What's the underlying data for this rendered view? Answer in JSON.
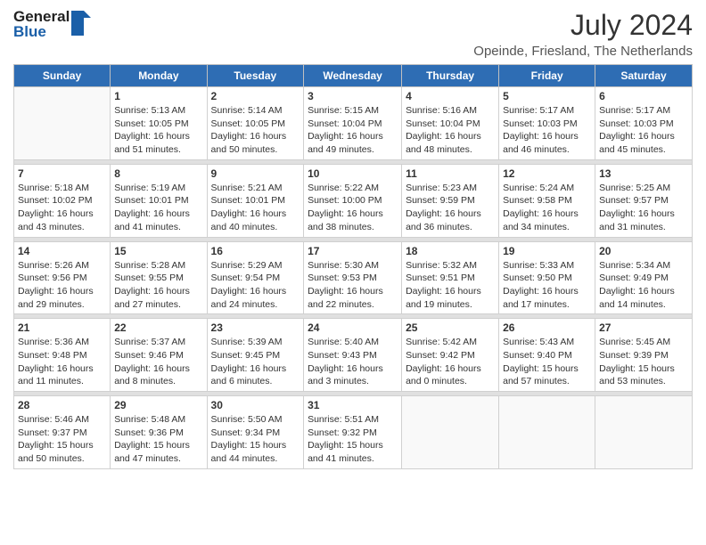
{
  "header": {
    "logo_general": "General",
    "logo_blue": "Blue",
    "month_year": "July 2024",
    "location": "Opeinde, Friesland, The Netherlands"
  },
  "days_of_week": [
    "Sunday",
    "Monday",
    "Tuesday",
    "Wednesday",
    "Thursday",
    "Friday",
    "Saturday"
  ],
  "weeks": [
    [
      {
        "day": "",
        "sunrise": "",
        "sunset": "",
        "daylight": ""
      },
      {
        "day": "1",
        "sunrise": "Sunrise: 5:13 AM",
        "sunset": "Sunset: 10:05 PM",
        "daylight": "Daylight: 16 hours and 51 minutes."
      },
      {
        "day": "2",
        "sunrise": "Sunrise: 5:14 AM",
        "sunset": "Sunset: 10:05 PM",
        "daylight": "Daylight: 16 hours and 50 minutes."
      },
      {
        "day": "3",
        "sunrise": "Sunrise: 5:15 AM",
        "sunset": "Sunset: 10:04 PM",
        "daylight": "Daylight: 16 hours and 49 minutes."
      },
      {
        "day": "4",
        "sunrise": "Sunrise: 5:16 AM",
        "sunset": "Sunset: 10:04 PM",
        "daylight": "Daylight: 16 hours and 48 minutes."
      },
      {
        "day": "5",
        "sunrise": "Sunrise: 5:17 AM",
        "sunset": "Sunset: 10:03 PM",
        "daylight": "Daylight: 16 hours and 46 minutes."
      },
      {
        "day": "6",
        "sunrise": "Sunrise: 5:17 AM",
        "sunset": "Sunset: 10:03 PM",
        "daylight": "Daylight: 16 hours and 45 minutes."
      }
    ],
    [
      {
        "day": "7",
        "sunrise": "Sunrise: 5:18 AM",
        "sunset": "Sunset: 10:02 PM",
        "daylight": "Daylight: 16 hours and 43 minutes."
      },
      {
        "day": "8",
        "sunrise": "Sunrise: 5:19 AM",
        "sunset": "Sunset: 10:01 PM",
        "daylight": "Daylight: 16 hours and 41 minutes."
      },
      {
        "day": "9",
        "sunrise": "Sunrise: 5:21 AM",
        "sunset": "Sunset: 10:01 PM",
        "daylight": "Daylight: 16 hours and 40 minutes."
      },
      {
        "day": "10",
        "sunrise": "Sunrise: 5:22 AM",
        "sunset": "Sunset: 10:00 PM",
        "daylight": "Daylight: 16 hours and 38 minutes."
      },
      {
        "day": "11",
        "sunrise": "Sunrise: 5:23 AM",
        "sunset": "Sunset: 9:59 PM",
        "daylight": "Daylight: 16 hours and 36 minutes."
      },
      {
        "day": "12",
        "sunrise": "Sunrise: 5:24 AM",
        "sunset": "Sunset: 9:58 PM",
        "daylight": "Daylight: 16 hours and 34 minutes."
      },
      {
        "day": "13",
        "sunrise": "Sunrise: 5:25 AM",
        "sunset": "Sunset: 9:57 PM",
        "daylight": "Daylight: 16 hours and 31 minutes."
      }
    ],
    [
      {
        "day": "14",
        "sunrise": "Sunrise: 5:26 AM",
        "sunset": "Sunset: 9:56 PM",
        "daylight": "Daylight: 16 hours and 29 minutes."
      },
      {
        "day": "15",
        "sunrise": "Sunrise: 5:28 AM",
        "sunset": "Sunset: 9:55 PM",
        "daylight": "Daylight: 16 hours and 27 minutes."
      },
      {
        "day": "16",
        "sunrise": "Sunrise: 5:29 AM",
        "sunset": "Sunset: 9:54 PM",
        "daylight": "Daylight: 16 hours and 24 minutes."
      },
      {
        "day": "17",
        "sunrise": "Sunrise: 5:30 AM",
        "sunset": "Sunset: 9:53 PM",
        "daylight": "Daylight: 16 hours and 22 minutes."
      },
      {
        "day": "18",
        "sunrise": "Sunrise: 5:32 AM",
        "sunset": "Sunset: 9:51 PM",
        "daylight": "Daylight: 16 hours and 19 minutes."
      },
      {
        "day": "19",
        "sunrise": "Sunrise: 5:33 AM",
        "sunset": "Sunset: 9:50 PM",
        "daylight": "Daylight: 16 hours and 17 minutes."
      },
      {
        "day": "20",
        "sunrise": "Sunrise: 5:34 AM",
        "sunset": "Sunset: 9:49 PM",
        "daylight": "Daylight: 16 hours and 14 minutes."
      }
    ],
    [
      {
        "day": "21",
        "sunrise": "Sunrise: 5:36 AM",
        "sunset": "Sunset: 9:48 PM",
        "daylight": "Daylight: 16 hours and 11 minutes."
      },
      {
        "day": "22",
        "sunrise": "Sunrise: 5:37 AM",
        "sunset": "Sunset: 9:46 PM",
        "daylight": "Daylight: 16 hours and 8 minutes."
      },
      {
        "day": "23",
        "sunrise": "Sunrise: 5:39 AM",
        "sunset": "Sunset: 9:45 PM",
        "daylight": "Daylight: 16 hours and 6 minutes."
      },
      {
        "day": "24",
        "sunrise": "Sunrise: 5:40 AM",
        "sunset": "Sunset: 9:43 PM",
        "daylight": "Daylight: 16 hours and 3 minutes."
      },
      {
        "day": "25",
        "sunrise": "Sunrise: 5:42 AM",
        "sunset": "Sunset: 9:42 PM",
        "daylight": "Daylight: 16 hours and 0 minutes."
      },
      {
        "day": "26",
        "sunrise": "Sunrise: 5:43 AM",
        "sunset": "Sunset: 9:40 PM",
        "daylight": "Daylight: 15 hours and 57 minutes."
      },
      {
        "day": "27",
        "sunrise": "Sunrise: 5:45 AM",
        "sunset": "Sunset: 9:39 PM",
        "daylight": "Daylight: 15 hours and 53 minutes."
      }
    ],
    [
      {
        "day": "28",
        "sunrise": "Sunrise: 5:46 AM",
        "sunset": "Sunset: 9:37 PM",
        "daylight": "Daylight: 15 hours and 50 minutes."
      },
      {
        "day": "29",
        "sunrise": "Sunrise: 5:48 AM",
        "sunset": "Sunset: 9:36 PM",
        "daylight": "Daylight: 15 hours and 47 minutes."
      },
      {
        "day": "30",
        "sunrise": "Sunrise: 5:50 AM",
        "sunset": "Sunset: 9:34 PM",
        "daylight": "Daylight: 15 hours and 44 minutes."
      },
      {
        "day": "31",
        "sunrise": "Sunrise: 5:51 AM",
        "sunset": "Sunset: 9:32 PM",
        "daylight": "Daylight: 15 hours and 41 minutes."
      },
      {
        "day": "",
        "sunrise": "",
        "sunset": "",
        "daylight": ""
      },
      {
        "day": "",
        "sunrise": "",
        "sunset": "",
        "daylight": ""
      },
      {
        "day": "",
        "sunrise": "",
        "sunset": "",
        "daylight": ""
      }
    ]
  ]
}
